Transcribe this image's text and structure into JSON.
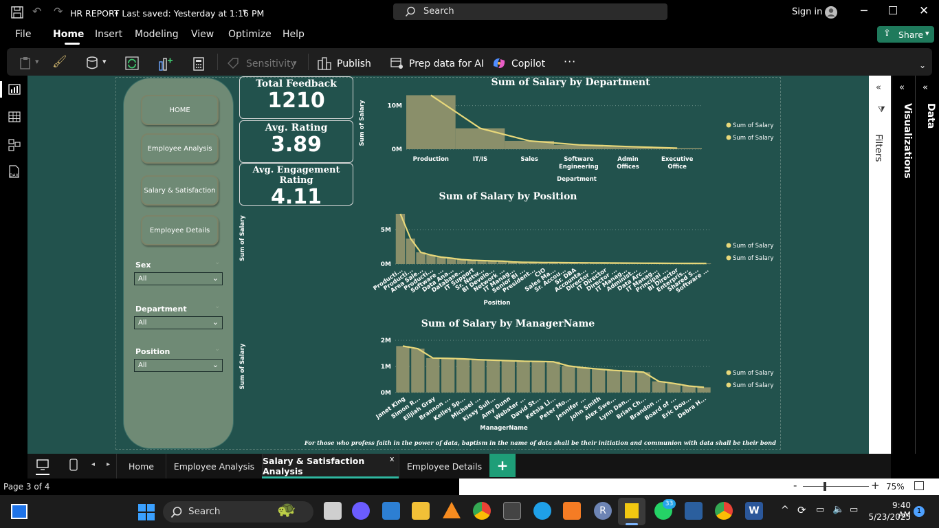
{
  "window": {
    "title": "HR REPORT",
    "saved_status": "• Last saved: Yesterday at 1:16 PM",
    "search_placeholder": "Search",
    "sign_in": "Sign in",
    "share": "Share"
  },
  "menu": [
    "File",
    "Home",
    "Insert",
    "Modeling",
    "View",
    "Optimize",
    "Help"
  ],
  "ribbon": {
    "sensitivity": "Sensitivity",
    "publish": "Publish",
    "prep_data": "Prep data for AI",
    "copilot": "Copilot",
    "more": "···"
  },
  "nav_buttons": [
    "HOME",
    "Employee Analysis",
    "Salary & Satisfaction",
    "Employee Details"
  ],
  "slicers": [
    {
      "label": "Sex",
      "value": "All"
    },
    {
      "label": "Department",
      "value": "All"
    },
    {
      "label": "Position",
      "value": "All"
    }
  ],
  "kpis": [
    {
      "title": "Total Feedback",
      "value": "1210"
    },
    {
      "title": "Avg. Rating",
      "value": "3.89"
    },
    {
      "title": "Avg. Engagement Rating",
      "value": "4.11"
    }
  ],
  "chart_data": [
    {
      "type": "bar",
      "title": "Sum of Salary by Department",
      "xlabel": "Department",
      "ylabel": "Sum of Salary",
      "ylim": [
        0,
        12000000
      ],
      "yticks": [
        "0M",
        "10M"
      ],
      "categories": [
        "Production",
        "IT/IS",
        "Sales",
        "Software Engineering",
        "Admin Offices",
        "Executive Office"
      ],
      "series": [
        {
          "name": "Sum of Salary",
          "values": [
            12400000,
            4800000,
            1900000,
            1000000,
            600000,
            250000
          ]
        },
        {
          "name": "Sum of Salary",
          "values": [
            12400000,
            4800000,
            1900000,
            1000000,
            600000,
            250000
          ]
        }
      ],
      "legend": "right"
    },
    {
      "type": "bar",
      "title": "Sum of Salary by Position",
      "xlabel": "Position",
      "ylabel": "Sum of Salary",
      "ylim": [
        0,
        7500000
      ],
      "yticks": [
        "0M",
        "5M"
      ],
      "categories": [
        "Producti...",
        "Producti...",
        "Area Sale...",
        "Producti...",
        "Software ...",
        "Data Ana...",
        "Database...",
        "IT Support",
        "Sr. Netw...",
        "BI Develo...",
        "Network ...",
        "IT Manag...",
        "Senior BI ...",
        "President...",
        "CIO",
        "Sales Ma...",
        "Sr. Accou...",
        "Sr. DBA",
        "Accounta...",
        "Director ...",
        "IT Director",
        "Director ...",
        "IT Manag...",
        "Administ...",
        "Data Arc...",
        "IT Manag...",
        "Principal ...",
        "BI Director",
        "Enterpris...",
        "Shared S...",
        "Software ..."
      ],
      "series": [
        {
          "name": "Sum of Salary",
          "values": [
            7300000,
            3700000,
            1700000,
            1300000,
            1000000,
            850000,
            650000,
            550000,
            500000,
            450000,
            420000,
            300000,
            250000,
            240000,
            220000,
            210000,
            200000,
            190000,
            180000,
            170000,
            160000,
            150000,
            140000,
            130000,
            120000,
            110000,
            100000,
            95000,
            90000,
            85000,
            80000
          ]
        },
        {
          "name": "Sum of Salary",
          "values": [
            7300000,
            3700000,
            1700000,
            1300000,
            1000000,
            850000,
            650000,
            550000,
            500000,
            450000,
            420000,
            300000,
            250000,
            240000,
            220000,
            210000,
            200000,
            190000,
            180000,
            170000,
            160000,
            150000,
            140000,
            130000,
            120000,
            110000,
            100000,
            95000,
            90000,
            85000,
            80000
          ]
        }
      ],
      "legend": "right"
    },
    {
      "type": "bar",
      "title": "Sum of Salary by ManagerName",
      "xlabel": "ManagerName",
      "ylabel": "Sum of Salary",
      "ylim": [
        0,
        2000000
      ],
      "yticks": [
        "0M",
        "1M",
        "2M"
      ],
      "categories": [
        "Janet King",
        "Simon R...",
        "Elijiah Gray",
        "Brannon ...",
        "Kelley Sp...",
        "Michael ...",
        "Kissy Sull...",
        "Amy Dunn",
        "Webster ...",
        "David St...",
        "Ketsia Li...",
        "Peter Mo...",
        "Jennifer ...",
        "John Smith",
        "Alex Swe...",
        "Lynn Dan...",
        "Brian Ch...",
        "Brandon ...",
        "Board of ...",
        "Eric Dou...",
        "Debra H..."
      ],
      "series": [
        {
          "name": "Sum of Salary",
          "values": [
            1780000,
            1680000,
            1320000,
            1310000,
            1290000,
            1260000,
            1240000,
            1220000,
            1200000,
            1190000,
            1180000,
            1020000,
            950000,
            900000,
            850000,
            820000,
            780000,
            430000,
            350000,
            250000,
            200000
          ]
        },
        {
          "name": "Sum of Salary",
          "values": [
            1780000,
            1680000,
            1320000,
            1310000,
            1290000,
            1260000,
            1240000,
            1220000,
            1200000,
            1190000,
            1180000,
            1020000,
            950000,
            900000,
            850000,
            820000,
            780000,
            430000,
            350000,
            250000,
            200000
          ]
        }
      ],
      "legend": "right"
    }
  ],
  "footer_quote": "For those who profess faith in the power of data, baptism in the name of data shall be their initiation and communion with data shall be their bond",
  "panes": {
    "filters": "Filters",
    "visualizations": "Visualizations",
    "data": "Data"
  },
  "tabs": [
    {
      "label": "Home",
      "active": false
    },
    {
      "label": "Employee Analysis",
      "active": false
    },
    {
      "label": "Salary & Satisfaction Analysis",
      "active": true
    },
    {
      "label": "Employee Details",
      "active": false
    }
  ],
  "tab_add": "+",
  "tab_close": "x",
  "status": {
    "page": "Page 3 of 4",
    "zoom": "75%"
  },
  "taskbar": {
    "search": "Search",
    "whatsapp_badge": "33",
    "time": "9:40 AM",
    "date": "5/23/2025",
    "notifications": "1"
  },
  "colors": {
    "canvas": "#22524d",
    "nav_panel": "#6f8a75",
    "bar": "#8a8f6a",
    "line": "#e8d87a",
    "tab_active_accent": "#2fb7a0",
    "share_button": "#1f7a5c"
  }
}
